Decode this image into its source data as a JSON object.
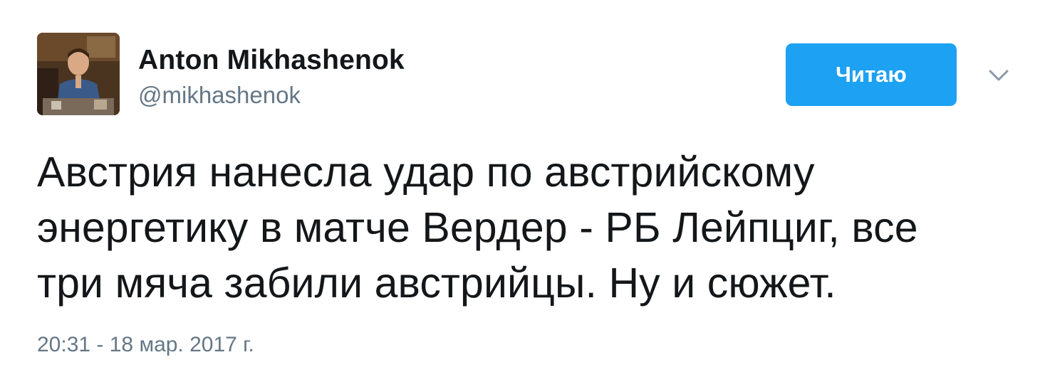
{
  "user": {
    "display_name": "Anton Mikhashenok",
    "handle": "@mikhashenok"
  },
  "follow_button": {
    "label": "Читаю"
  },
  "tweet": {
    "text": "Австрия нанесла удар по австрийскому\nэнергетику в матче Вердер - РБ Лейпциг, все\nтри мяча забили австрийцы. Ну и сюжет.",
    "timestamp": "20:31 - 18 мар. 2017 г."
  },
  "colors": {
    "accent": "#1da1f2",
    "text_primary": "#14171a",
    "text_secondary": "#657786",
    "caret": "#8899a6"
  },
  "icons": {
    "caret": "chevron-down-icon"
  }
}
